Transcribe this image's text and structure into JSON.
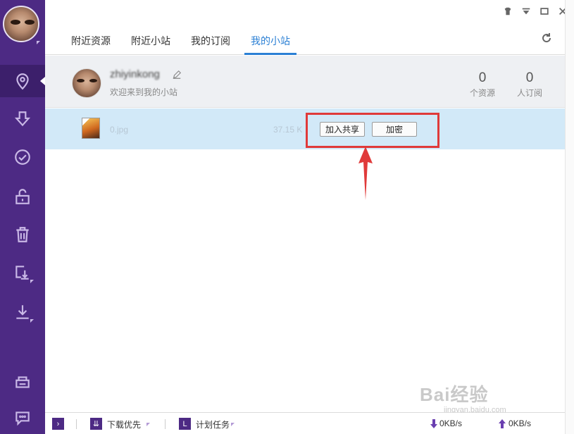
{
  "window": {
    "controls": [
      "skin-icon",
      "menu-icon",
      "minimize-icon",
      "close-icon"
    ]
  },
  "sidebar": {
    "items": [
      {
        "name": "location",
        "active": true
      },
      {
        "name": "download",
        "active": false
      },
      {
        "name": "completed",
        "active": false
      },
      {
        "name": "unlock",
        "active": false
      },
      {
        "name": "trash",
        "active": false
      },
      {
        "name": "import",
        "active": false
      },
      {
        "name": "download-manager",
        "active": false
      },
      {
        "name": "print",
        "active": false
      },
      {
        "name": "chat",
        "active": false
      }
    ]
  },
  "tabs": [
    {
      "label": "附近资源"
    },
    {
      "label": "附近小站"
    },
    {
      "label": "我的订阅"
    },
    {
      "label": "我的小站",
      "active": true
    }
  ],
  "profile": {
    "username": "zhiyinkong",
    "welcome": "欢迎来到我的小站",
    "stats": [
      {
        "value": "0",
        "label": "个资源"
      },
      {
        "value": "0",
        "label": "人订阅"
      }
    ]
  },
  "file": {
    "name": "0.jpg",
    "size": "37.15 K",
    "share_button": "加入共享",
    "encrypt_button": "加密"
  },
  "status": {
    "priority_label": "下载优先",
    "schedule_label": "计划任务",
    "download_speed": "0KB/s",
    "upload_speed": "0KB/s"
  },
  "watermark": {
    "text": "Bai经验",
    "sub": "jingyan.baidu.com"
  },
  "colors": {
    "sidebar": "#4d2a84",
    "accent": "#2a7fd4",
    "highlight": "#e03a3a",
    "row": "#d2e9f8"
  }
}
